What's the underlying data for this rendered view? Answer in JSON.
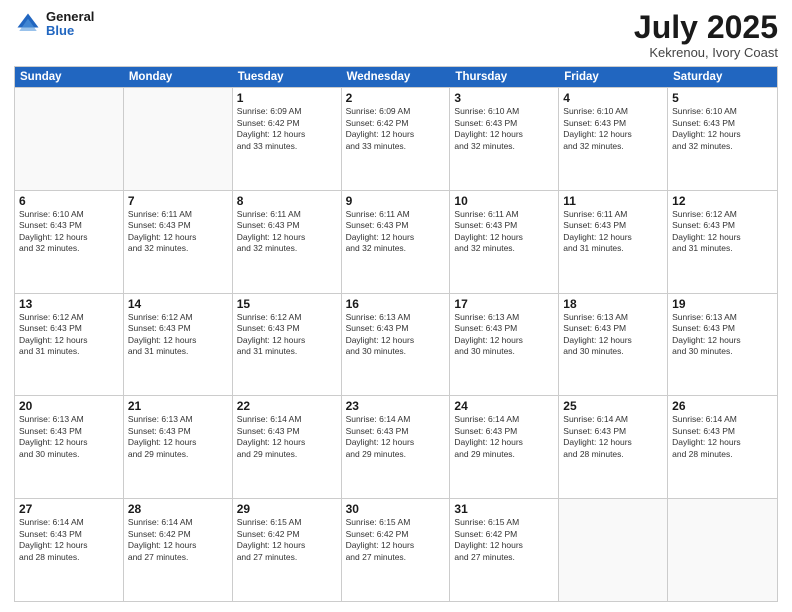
{
  "logo": {
    "line1": "General",
    "line2": "Blue"
  },
  "title": "July 2025",
  "location": "Kekrenou, Ivory Coast",
  "header_days": [
    "Sunday",
    "Monday",
    "Tuesday",
    "Wednesday",
    "Thursday",
    "Friday",
    "Saturday"
  ],
  "weeks": [
    [
      {
        "day": "",
        "info": ""
      },
      {
        "day": "",
        "info": ""
      },
      {
        "day": "1",
        "info": "Sunrise: 6:09 AM\nSunset: 6:42 PM\nDaylight: 12 hours\nand 33 minutes."
      },
      {
        "day": "2",
        "info": "Sunrise: 6:09 AM\nSunset: 6:42 PM\nDaylight: 12 hours\nand 33 minutes."
      },
      {
        "day": "3",
        "info": "Sunrise: 6:10 AM\nSunset: 6:43 PM\nDaylight: 12 hours\nand 32 minutes."
      },
      {
        "day": "4",
        "info": "Sunrise: 6:10 AM\nSunset: 6:43 PM\nDaylight: 12 hours\nand 32 minutes."
      },
      {
        "day": "5",
        "info": "Sunrise: 6:10 AM\nSunset: 6:43 PM\nDaylight: 12 hours\nand 32 minutes."
      }
    ],
    [
      {
        "day": "6",
        "info": "Sunrise: 6:10 AM\nSunset: 6:43 PM\nDaylight: 12 hours\nand 32 minutes."
      },
      {
        "day": "7",
        "info": "Sunrise: 6:11 AM\nSunset: 6:43 PM\nDaylight: 12 hours\nand 32 minutes."
      },
      {
        "day": "8",
        "info": "Sunrise: 6:11 AM\nSunset: 6:43 PM\nDaylight: 12 hours\nand 32 minutes."
      },
      {
        "day": "9",
        "info": "Sunrise: 6:11 AM\nSunset: 6:43 PM\nDaylight: 12 hours\nand 32 minutes."
      },
      {
        "day": "10",
        "info": "Sunrise: 6:11 AM\nSunset: 6:43 PM\nDaylight: 12 hours\nand 32 minutes."
      },
      {
        "day": "11",
        "info": "Sunrise: 6:11 AM\nSunset: 6:43 PM\nDaylight: 12 hours\nand 31 minutes."
      },
      {
        "day": "12",
        "info": "Sunrise: 6:12 AM\nSunset: 6:43 PM\nDaylight: 12 hours\nand 31 minutes."
      }
    ],
    [
      {
        "day": "13",
        "info": "Sunrise: 6:12 AM\nSunset: 6:43 PM\nDaylight: 12 hours\nand 31 minutes."
      },
      {
        "day": "14",
        "info": "Sunrise: 6:12 AM\nSunset: 6:43 PM\nDaylight: 12 hours\nand 31 minutes."
      },
      {
        "day": "15",
        "info": "Sunrise: 6:12 AM\nSunset: 6:43 PM\nDaylight: 12 hours\nand 31 minutes."
      },
      {
        "day": "16",
        "info": "Sunrise: 6:13 AM\nSunset: 6:43 PM\nDaylight: 12 hours\nand 30 minutes."
      },
      {
        "day": "17",
        "info": "Sunrise: 6:13 AM\nSunset: 6:43 PM\nDaylight: 12 hours\nand 30 minutes."
      },
      {
        "day": "18",
        "info": "Sunrise: 6:13 AM\nSunset: 6:43 PM\nDaylight: 12 hours\nand 30 minutes."
      },
      {
        "day": "19",
        "info": "Sunrise: 6:13 AM\nSunset: 6:43 PM\nDaylight: 12 hours\nand 30 minutes."
      }
    ],
    [
      {
        "day": "20",
        "info": "Sunrise: 6:13 AM\nSunset: 6:43 PM\nDaylight: 12 hours\nand 30 minutes."
      },
      {
        "day": "21",
        "info": "Sunrise: 6:13 AM\nSunset: 6:43 PM\nDaylight: 12 hours\nand 29 minutes."
      },
      {
        "day": "22",
        "info": "Sunrise: 6:14 AM\nSunset: 6:43 PM\nDaylight: 12 hours\nand 29 minutes."
      },
      {
        "day": "23",
        "info": "Sunrise: 6:14 AM\nSunset: 6:43 PM\nDaylight: 12 hours\nand 29 minutes."
      },
      {
        "day": "24",
        "info": "Sunrise: 6:14 AM\nSunset: 6:43 PM\nDaylight: 12 hours\nand 29 minutes."
      },
      {
        "day": "25",
        "info": "Sunrise: 6:14 AM\nSunset: 6:43 PM\nDaylight: 12 hours\nand 28 minutes."
      },
      {
        "day": "26",
        "info": "Sunrise: 6:14 AM\nSunset: 6:43 PM\nDaylight: 12 hours\nand 28 minutes."
      }
    ],
    [
      {
        "day": "27",
        "info": "Sunrise: 6:14 AM\nSunset: 6:43 PM\nDaylight: 12 hours\nand 28 minutes."
      },
      {
        "day": "28",
        "info": "Sunrise: 6:14 AM\nSunset: 6:42 PM\nDaylight: 12 hours\nand 27 minutes."
      },
      {
        "day": "29",
        "info": "Sunrise: 6:15 AM\nSunset: 6:42 PM\nDaylight: 12 hours\nand 27 minutes."
      },
      {
        "day": "30",
        "info": "Sunrise: 6:15 AM\nSunset: 6:42 PM\nDaylight: 12 hours\nand 27 minutes."
      },
      {
        "day": "31",
        "info": "Sunrise: 6:15 AM\nSunset: 6:42 PM\nDaylight: 12 hours\nand 27 minutes."
      },
      {
        "day": "",
        "info": ""
      },
      {
        "day": "",
        "info": ""
      }
    ]
  ]
}
